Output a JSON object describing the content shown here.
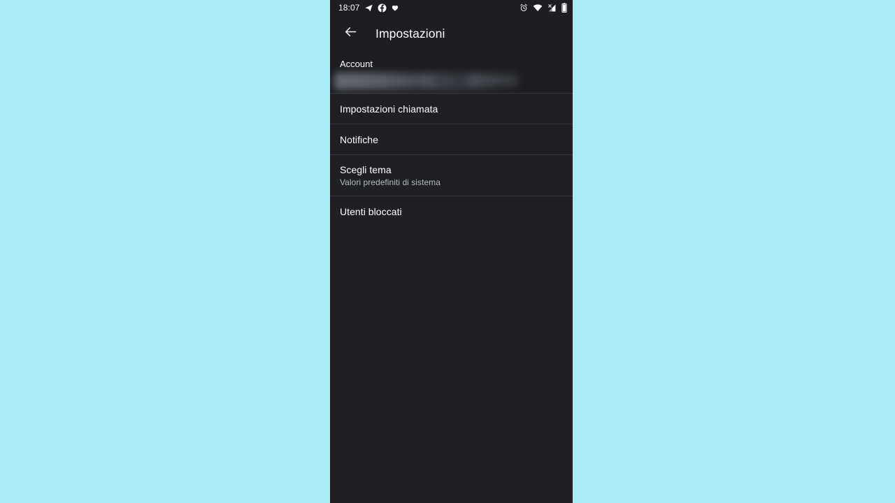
{
  "colors": {
    "page_background": "#a7ecf7",
    "app_background": "#1f2024",
    "bar_background": "#1d1e22",
    "divider": "#35373c",
    "primary_text": "#ffffff",
    "secondary_text": "#b6b9bd"
  },
  "status_bar": {
    "time": "18:07",
    "left_icons": [
      "telegram-icon",
      "facebook-icon",
      "heart-icon"
    ],
    "right_icons": [
      "alarm-icon",
      "wifi-icon",
      "cellular-signal-off-icon",
      "battery-icon"
    ]
  },
  "toolbar": {
    "back_icon": "arrow-back-icon",
    "title": "Impostazioni"
  },
  "account": {
    "label": "Account",
    "value_redacted": true
  },
  "settings_list": [
    {
      "title": "Impostazioni chiamata",
      "subtitle": ""
    },
    {
      "title": "Notifiche",
      "subtitle": ""
    },
    {
      "title": "Scegli tema",
      "subtitle": "Valori predefiniti di sistema"
    },
    {
      "title": "Utenti bloccati",
      "subtitle": ""
    }
  ]
}
